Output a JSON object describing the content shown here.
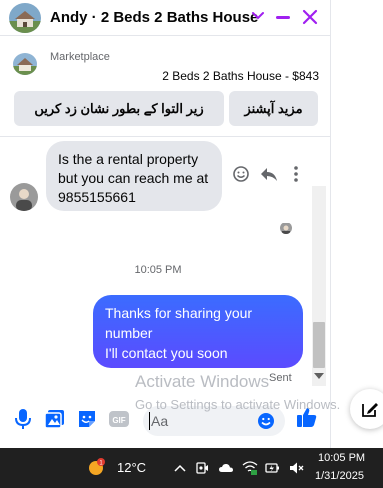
{
  "header": {
    "title": "Andy · 2 Beds 2 Baths House"
  },
  "listing": {
    "source": "Marketplace",
    "title": "2 Beds 2 Baths House - $843",
    "buttons": {
      "mark_label": "زیر التوا کے بطور نشان زد کریں",
      "more_label": "مزید آپشنز"
    }
  },
  "messages": {
    "incoming": {
      "text": "Is the a rental property but you can reach me at 9855155661"
    },
    "timestamp": "10:05 PM",
    "outgoing": {
      "line1": "Thanks for sharing your number",
      "line2": "I'll contact you soon"
    },
    "status": "Sent"
  },
  "composer": {
    "placeholder": "Aa",
    "gif_label": "GIF"
  },
  "watermark": {
    "line1": "Activate Windows",
    "line2": "Go to Settings to activate Windows."
  },
  "taskbar": {
    "weather": "12°C",
    "weather_badge": "1",
    "time": "10:05 PM",
    "date": "1/31/2025"
  },
  "colors": {
    "accent": "#a020f0",
    "messenger_blue": "#0866ff",
    "outgoing_top": "#3b6cff",
    "outgoing_bottom": "#5b4bff"
  }
}
